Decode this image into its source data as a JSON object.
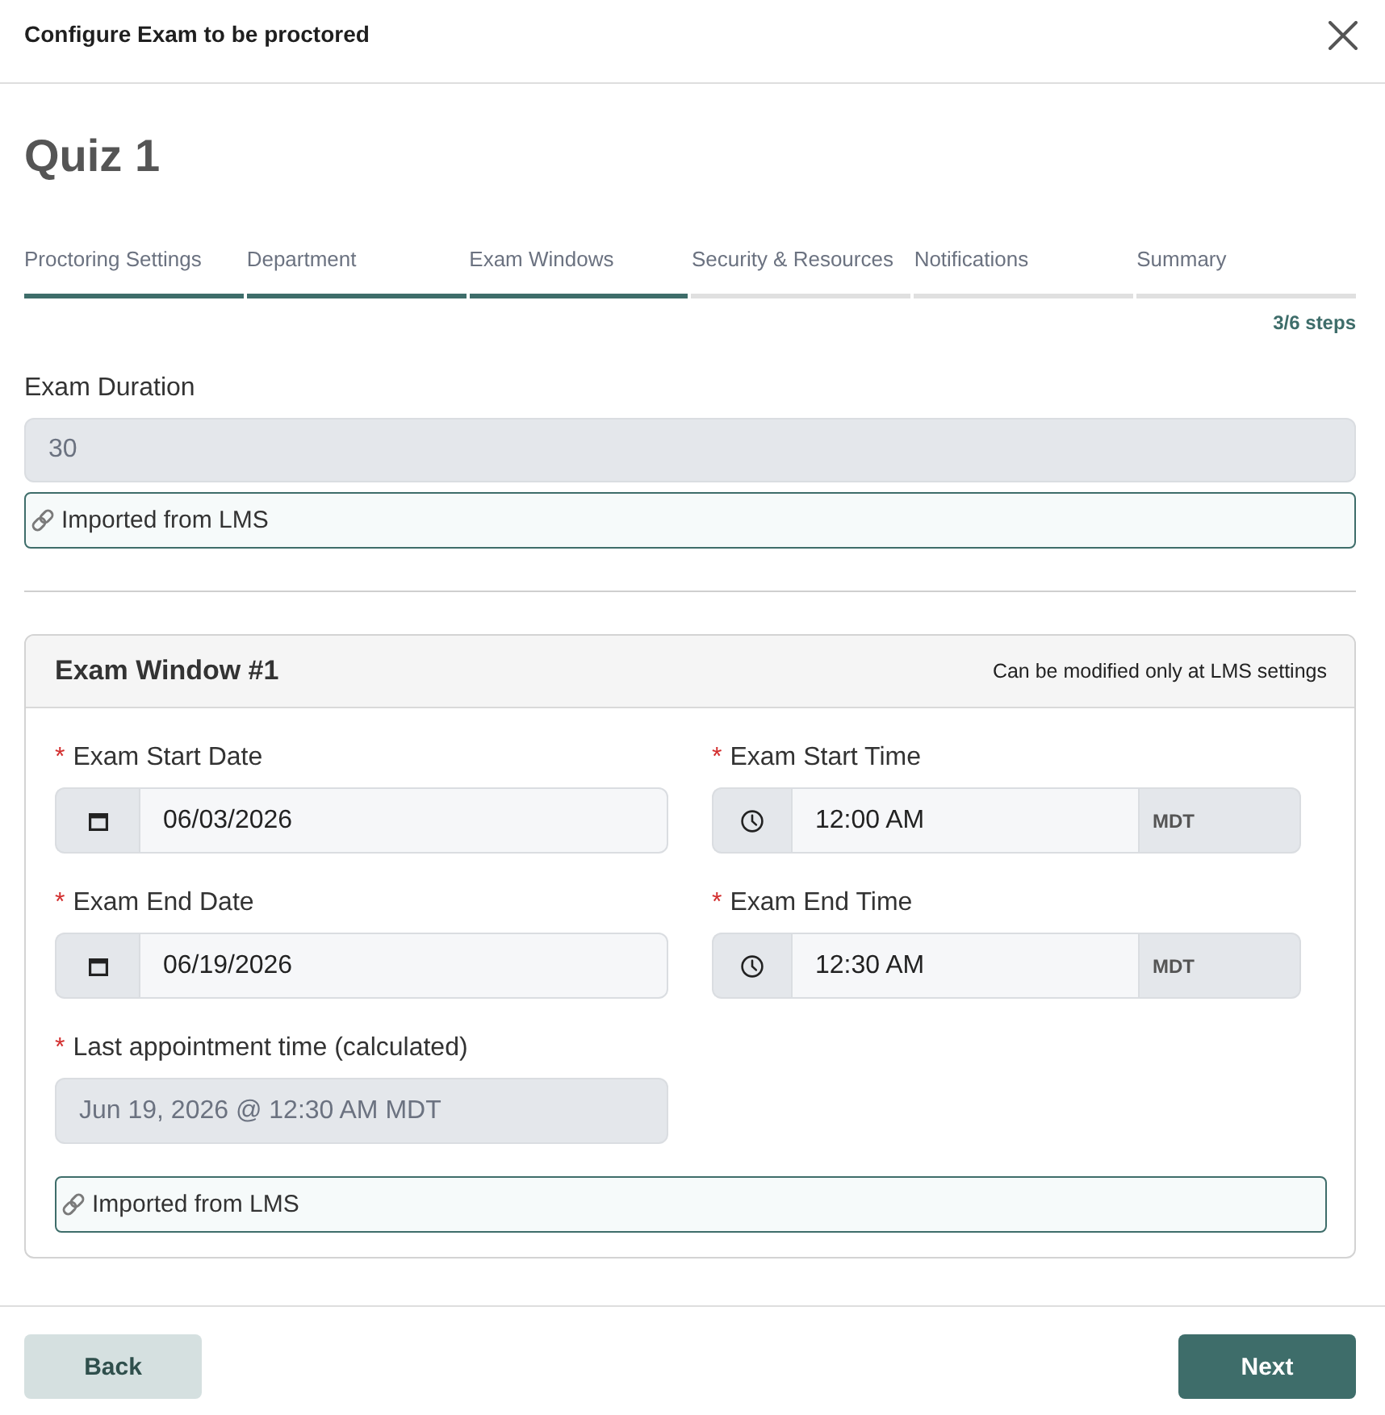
{
  "dialog": {
    "title": "Configure Exam to be proctored"
  },
  "exam": {
    "title": "Quiz 1"
  },
  "steps": [
    {
      "label": "Proctoring Settings",
      "completed": true
    },
    {
      "label": "Department",
      "completed": true
    },
    {
      "label": "Exam Windows",
      "completed": true
    },
    {
      "label": "Security & Resources",
      "completed": false
    },
    {
      "label": "Notifications",
      "completed": false
    },
    {
      "label": "Summary",
      "completed": false
    }
  ],
  "progress": {
    "text": "3/6 steps"
  },
  "duration": {
    "label": "Exam Duration",
    "kind": "text",
    "value": "30",
    "disabled": true,
    "note": "Imported from LMS"
  },
  "exam_window": {
    "title": "Exam Window #1",
    "hint": "Can be modified only at LMS settings",
    "fields": [
      {
        "kind": "date",
        "required_mark": "*",
        "label": "Exam Start Date",
        "value": "06/03/2026",
        "disabled": false
      },
      {
        "kind": "time",
        "required_mark": "*",
        "label": "Exam Start Time",
        "value": "12:00 AM",
        "zone": "MDT",
        "disabled": false
      },
      {
        "kind": "date",
        "required_mark": "*",
        "label": "Exam End Date",
        "value": "06/19/2026",
        "disabled": false
      },
      {
        "kind": "time",
        "required_mark": "*",
        "label": "Exam End Time",
        "value": "12:30 AM",
        "zone": "MDT",
        "disabled": false
      },
      {
        "kind": "text",
        "required_mark": "*",
        "label": "Last appointment time (calculated)",
        "value": "Jun 19, 2026 @ 12:30 AM MDT",
        "disabled": true
      }
    ],
    "note": "Imported from LMS"
  },
  "buttons": [
    {
      "label": "Back",
      "kind": "secondary"
    },
    {
      "label": "Next",
      "kind": "primary"
    }
  ]
}
